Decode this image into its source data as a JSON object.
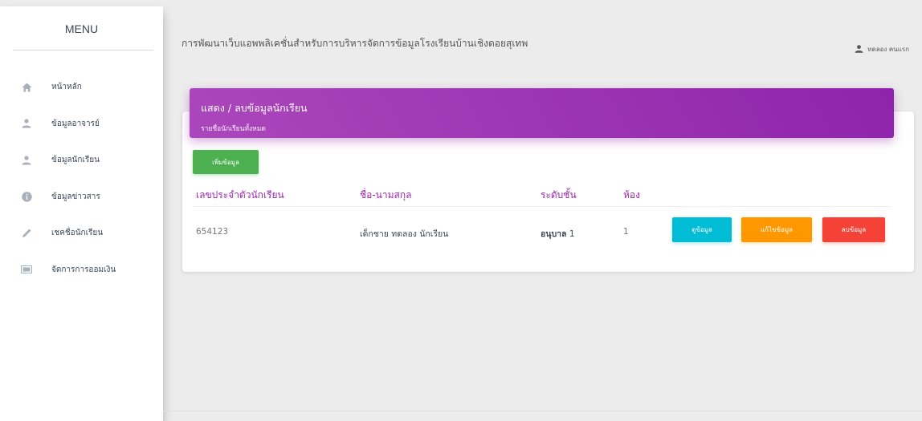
{
  "sidebar": {
    "title": "MENU",
    "items": [
      {
        "label": "หน้าหลัก",
        "icon": "home-icon"
      },
      {
        "label": "ข้อมูลอาจารย์",
        "icon": "person-icon"
      },
      {
        "label": "ข้อมูลนักเรียน",
        "icon": "person-icon"
      },
      {
        "label": "ข้อมูลข่าวสาร",
        "icon": "info-icon"
      },
      {
        "label": "เชคชื่อนักเรียน",
        "icon": "pencil-icon"
      },
      {
        "label": "จัดการการออมเงิน",
        "icon": "money-icon"
      }
    ]
  },
  "header": {
    "title": "การพัฒนาเว็บแอพพลิเคชั่นสำหรับการบริหารจัดการข้อมูลโรงเรียนบ้านเชิงดอยสุเทพ",
    "user_name": "ทดลอง คนแรก"
  },
  "card": {
    "title": "แสดง / ลบข้อมูลนักเรียน",
    "subtitle": "รายชื่อนักเรียนทั้งหมด",
    "add_button": "เพิ่มข้อมูล",
    "columns": [
      "เลขประจำตัวนักเรียน",
      "ชื่อ-นามสกุล",
      "ระดับชั้น",
      "ห้อง"
    ],
    "rows": [
      {
        "id": "654123",
        "name": "เด็กชาย ทดลอง นักเรียน",
        "level_bold": "อนุบาล",
        "level_num": " 1",
        "room": "1"
      }
    ],
    "actions": {
      "view": "ดูข้อมูล",
      "edit": "แก้ไขข้อมูล",
      "delete": "ลบข้อมูล"
    }
  },
  "colors": {
    "accent": "#9c27b0",
    "success": "#4caf50",
    "info": "#00bcd4",
    "warning": "#ff9800",
    "danger": "#f44336"
  }
}
